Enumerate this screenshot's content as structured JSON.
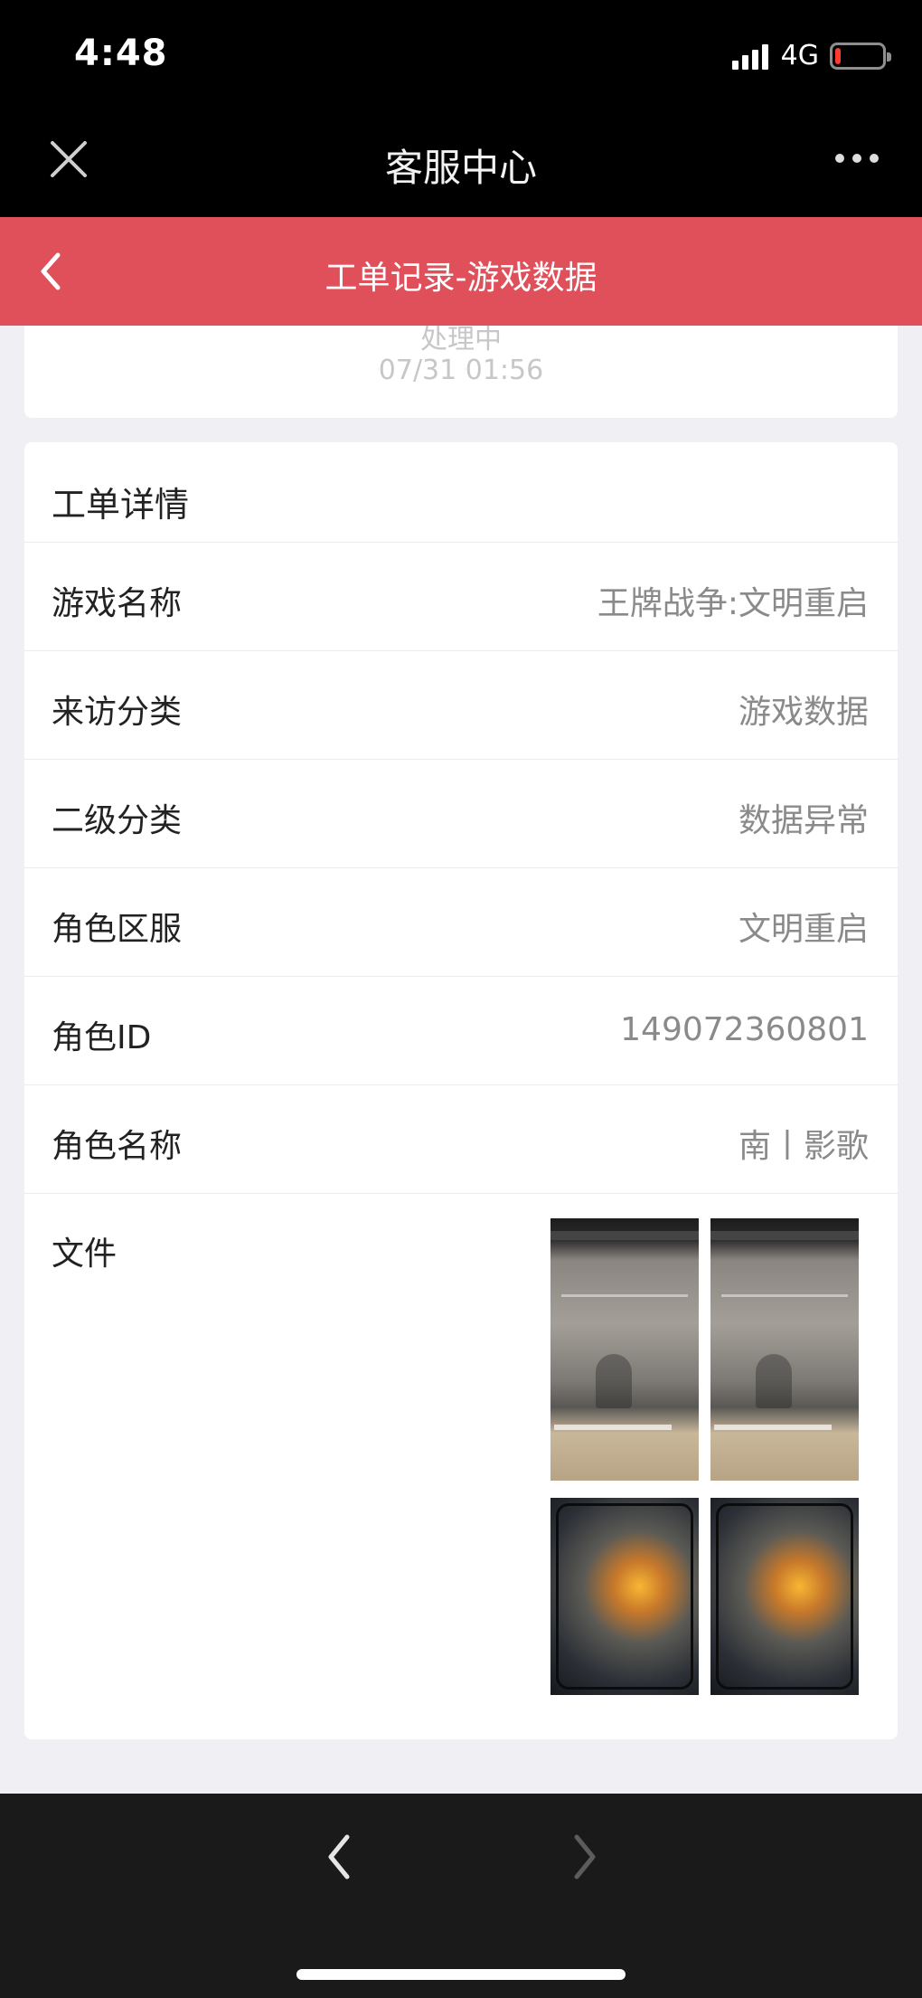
{
  "status_bar": {
    "time": "4:48",
    "network": "4G",
    "battery_level": 0.12,
    "signal_bars": 4
  },
  "app_header": {
    "title": "客服中心",
    "close_icon": "close-icon",
    "more_icon": "more-dots-icon"
  },
  "nav": {
    "title": "工单记录-游戏数据",
    "back_icon": "chevron-left-icon"
  },
  "ticket_status": {
    "status": "处理中",
    "time": "07/31 01:56"
  },
  "detail": {
    "title": "工单详情",
    "rows": [
      {
        "label": "游戏名称",
        "value": "王牌战争:文明重启"
      },
      {
        "label": "来访分类",
        "value": "游戏数据"
      },
      {
        "label": "二级分类",
        "value": "数据异常"
      },
      {
        "label": "角色区服",
        "value": "文明重启"
      },
      {
        "label": "角色ID",
        "value": "149072360801"
      },
      {
        "label": "角色名称",
        "value": "南丨影歌"
      }
    ],
    "files_label": "文件",
    "files": [
      "screenshot-thumbnail",
      "screenshot-thumbnail",
      "game-screenshot-thumbnail",
      "game-screenshot-thumbnail"
    ]
  },
  "bottom_bar": {
    "back_icon": "chevron-left-icon",
    "forward_icon": "chevron-right-icon"
  },
  "colors": {
    "nav_red": "#e0505a",
    "background": "#efeff4",
    "value_gray": "#8a8a8a"
  }
}
